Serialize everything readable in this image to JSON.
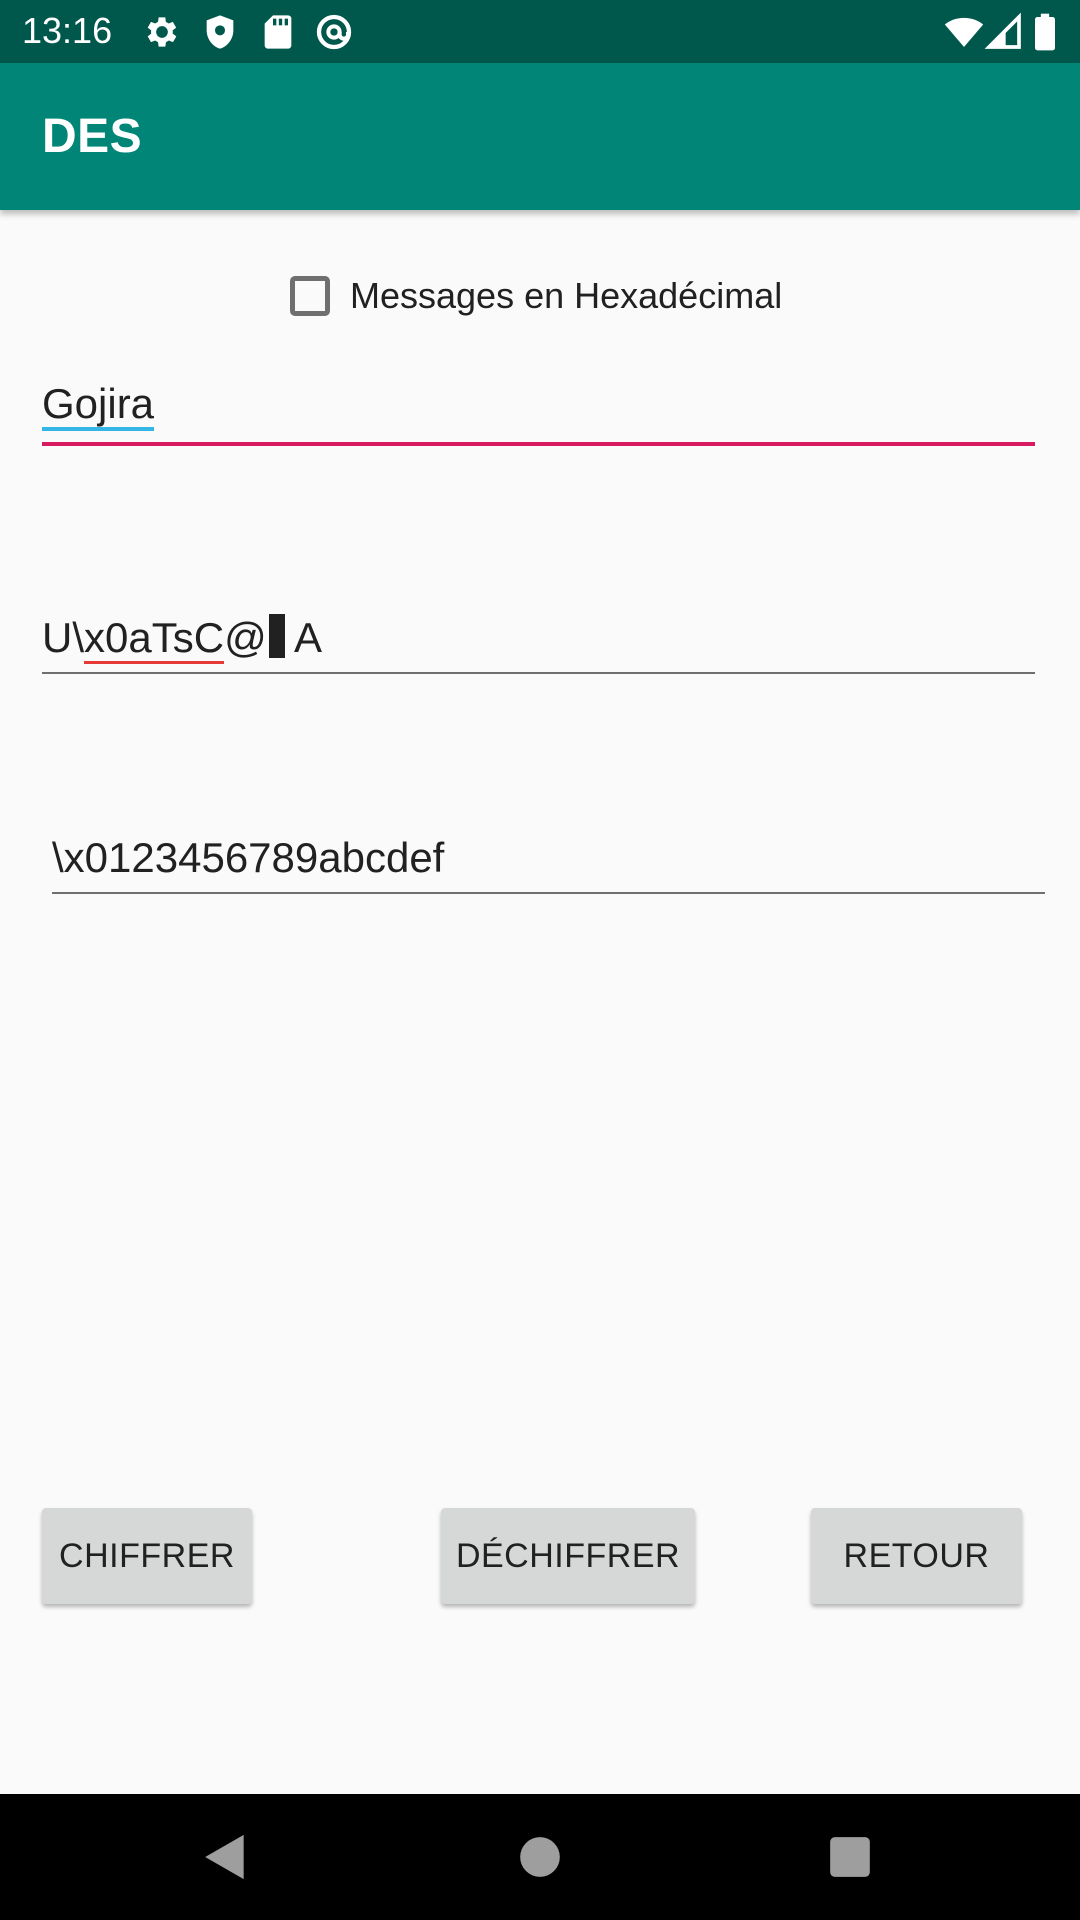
{
  "status_bar": {
    "time": "13:16",
    "icons": [
      "gear-icon",
      "shield-icon",
      "sd-card-icon",
      "at-sign-icon",
      "wifi-icon",
      "signal-icon",
      "battery-icon"
    ]
  },
  "app_bar": {
    "title": "DES"
  },
  "hex_checkbox": {
    "label": "Messages en Hexadécimal",
    "checked": false
  },
  "message_field": {
    "value": "Gojira",
    "focused": true
  },
  "result_field": {
    "prefix": "U\\",
    "misspelled": "x0aTsC",
    "middle": "@",
    "suffix": " A"
  },
  "key_field": {
    "value": "\\x0123456789abcdef"
  },
  "buttons": {
    "encrypt": "CHIFFRER",
    "decrypt": "DÉCHIFFRER",
    "back": "RETOUR"
  },
  "colors": {
    "status_bar": "#00574b",
    "app_bar": "#008577",
    "accent": "#d81b60",
    "button": "#d6d7d7"
  }
}
